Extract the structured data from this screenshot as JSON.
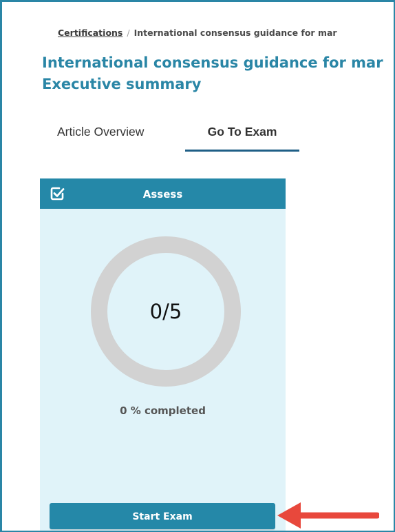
{
  "breadcrumb": {
    "root_label": "Certifications",
    "separator": "/",
    "current_label": "International consensus guidance for mar"
  },
  "page": {
    "title_line1": "International consensus guidance for mar",
    "title_line2": "Executive summary"
  },
  "tabs": [
    {
      "label": "Article Overview",
      "active": false
    },
    {
      "label": "Go To Exam",
      "active": true
    }
  ],
  "assess_card": {
    "header_icon": "checkbox-checked-icon",
    "header_title": "Assess",
    "progress_text": "0/5",
    "progress_fraction": 0,
    "completed_text": "0 % completed",
    "start_button_label": "Start Exam"
  },
  "colors": {
    "accent": "#2588a8",
    "title": "#2a86a6",
    "card_bg": "#e0f3f9",
    "ring": "#d2d2d2",
    "tab_underline": "#1f5f86",
    "annotation_arrow": "#e8483c"
  }
}
